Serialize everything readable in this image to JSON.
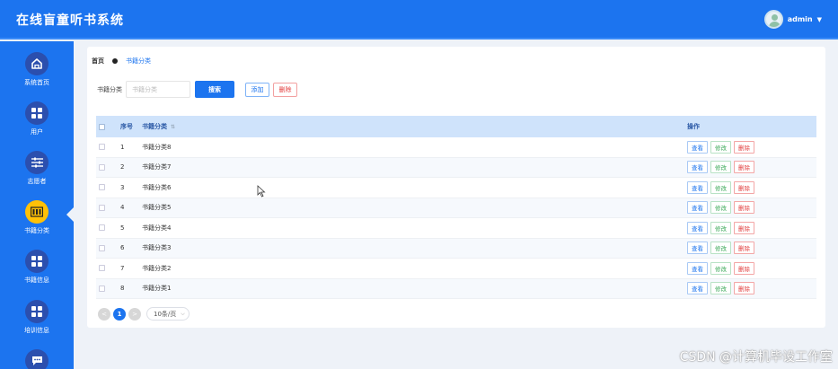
{
  "app": {
    "title": "在线盲童听书系统"
  },
  "user": {
    "name": "admin"
  },
  "sidebar": {
    "items": [
      {
        "label": "系统首页",
        "icon": "home-icon",
        "active": false
      },
      {
        "label": "用户",
        "icon": "grid-icon",
        "active": false
      },
      {
        "label": "志愿者",
        "icon": "sliders-icon",
        "active": false
      },
      {
        "label": "书籍分类",
        "icon": "book-icon",
        "active": true
      },
      {
        "label": "书籍信息",
        "icon": "grid-icon",
        "active": false
      },
      {
        "label": "培训信息",
        "icon": "grid-icon",
        "active": false
      },
      {
        "label": "",
        "icon": "chat-icon",
        "active": false
      }
    ]
  },
  "breadcrumb": {
    "home": "首页",
    "current": "书籍分类"
  },
  "search": {
    "label": "书籍分类",
    "placeholder": "书籍分类",
    "button": "搜索"
  },
  "actions": {
    "add": "添加",
    "delete": "删除"
  },
  "table": {
    "headers": {
      "index": "序号",
      "category": "书籍分类",
      "operation": "操作"
    },
    "rows": [
      {
        "index": "1",
        "category": "书籍分类8"
      },
      {
        "index": "2",
        "category": "书籍分类7"
      },
      {
        "index": "3",
        "category": "书籍分类6"
      },
      {
        "index": "4",
        "category": "书籍分类5"
      },
      {
        "index": "5",
        "category": "书籍分类4"
      },
      {
        "index": "6",
        "category": "书籍分类3"
      },
      {
        "index": "7",
        "category": "书籍分类2"
      },
      {
        "index": "8",
        "category": "书籍分类1"
      }
    ],
    "row_ops": {
      "view": "查看",
      "edit": "修改",
      "delete": "删除"
    }
  },
  "pagination": {
    "prev": "<",
    "current_page": "1",
    "next": ">",
    "page_size": "10条/页"
  },
  "watermark": "CSDN @计算机毕设工作室",
  "colors": {
    "primary": "#1c74ef",
    "active_nav": "#ffc107",
    "danger": "#e23c3c",
    "success": "#3aa857"
  }
}
